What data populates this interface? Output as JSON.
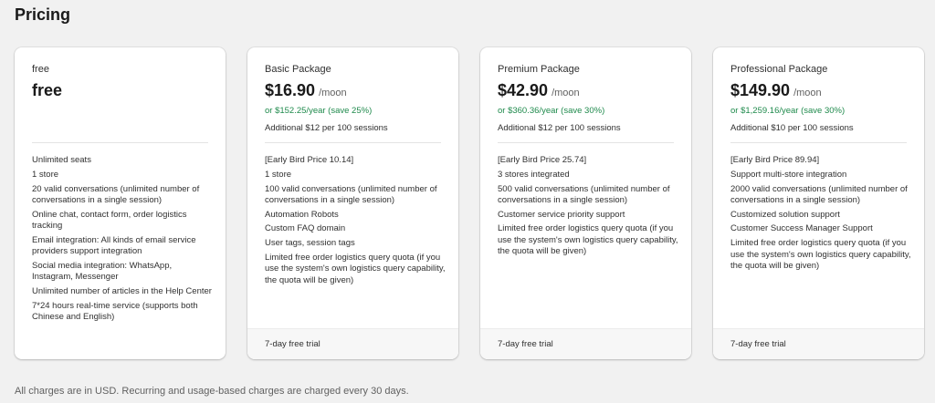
{
  "page": {
    "title": "Pricing",
    "note": "All charges are in USD. Recurring and usage-based charges are charged every 30 days."
  },
  "plans": [
    {
      "name": "free",
      "price": "free",
      "period": "",
      "yearly": "",
      "addon": "",
      "features": [
        "Unlimited seats",
        "1 store",
        "20 valid conversations (unlimited number of conversations in a single session)",
        "Online chat, contact form, order logistics tracking",
        "Email integration: All kinds of email service providers support integration",
        "Social media integration: WhatsApp, Instagram, Messenger",
        "Unlimited number of articles in the Help Center",
        "7*24 hours real-time service (supports both Chinese and English)"
      ],
      "trial": ""
    },
    {
      "name": "Basic Package",
      "price": "$16.90",
      "period": "/moon",
      "yearly": "or $152.25/year (save 25%)",
      "addon": "Additional $12 per 100 sessions",
      "features": [
        "[Early Bird Price 10.14]",
        "1 store",
        "100 valid conversations (unlimited number of conversations in a single session)",
        "Automation Robots",
        "Custom FAQ domain",
        "User tags, session tags",
        "Limited free order logistics query quota (if you use the system's own logistics query capability, the quota will be given)"
      ],
      "trial": "7-day free trial"
    },
    {
      "name": "Premium Package",
      "price": "$42.90",
      "period": "/moon",
      "yearly": "or $360.36/year (save 30%)",
      "addon": "Additional $12 per 100 sessions",
      "features": [
        "[Early Bird Price 25.74]",
        "3 stores integrated",
        "500 valid conversations (unlimited number of conversations in a single session)",
        "Customer service priority support",
        "Limited free order logistics query quota (if you use the system's own logistics query capability, the quota will be given)"
      ],
      "trial": "7-day free trial"
    },
    {
      "name": "Professional Package",
      "price": "$149.90",
      "period": "/moon",
      "yearly": "or $1,259.16/year (save 30%)",
      "addon": "Additional $10 per 100 sessions",
      "features": [
        "[Early Bird Price 89.94]",
        "Support multi-store integration",
        "2000 valid conversations (unlimited number of conversations in a single session)",
        "Customized solution support",
        "Customer Success Manager Support",
        "Limited free order logistics query quota (if you use the system's own logistics query capability, the quota will be given)"
      ],
      "trial": "7-day free trial"
    }
  ]
}
